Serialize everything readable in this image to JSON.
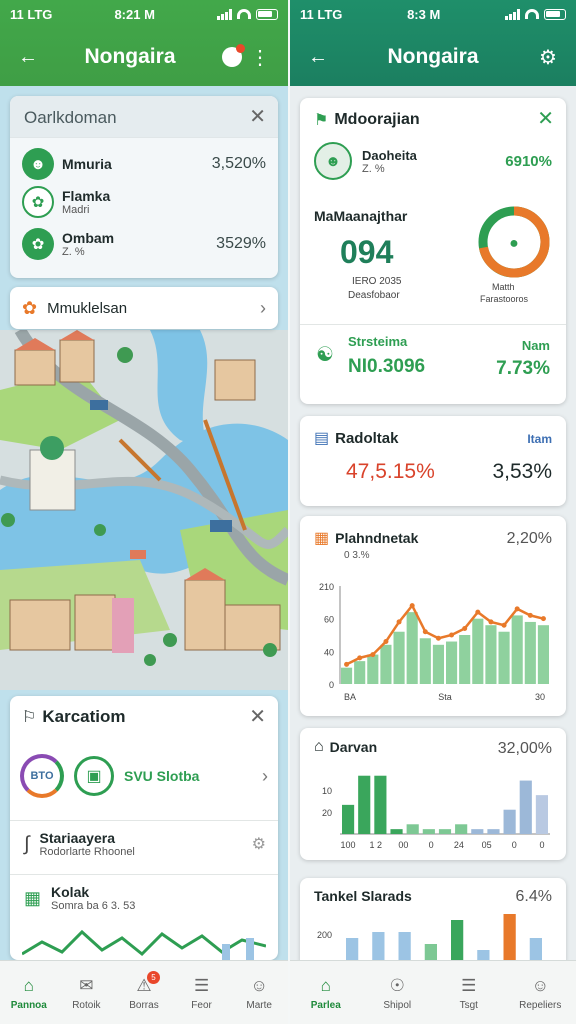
{
  "left": {
    "status": {
      "time_left": "11 LTG",
      "time": "8:21 M"
    },
    "appbar": {
      "title": "Nongaira"
    },
    "overview_card": {
      "title": "Oarlkdoman",
      "items": [
        {
          "label": "Mmuria",
          "sub": "",
          "value": "3,520%",
          "icon": "people-icon"
        },
        {
          "label": "Flamka",
          "sub": "Madri",
          "value": "",
          "icon": "leaf-icon"
        },
        {
          "label": "Ombam",
          "sub": "Z. %",
          "value": "3529%",
          "icon": "leaf-icon"
        }
      ]
    },
    "search_card": {
      "label": "Mmuklelsan"
    },
    "lower_card": {
      "title": "Karcatiom",
      "org_badge": "BTO",
      "link_label": "SVU Slotba",
      "items": [
        {
          "label": "Stariaayera",
          "sub": "Rodorlarte Rhoonel"
        },
        {
          "label": "Kolak",
          "sub": "Somra ba 6 3. 53"
        }
      ]
    },
    "nav": [
      {
        "label": "Pannoa",
        "icon": "home-icon",
        "active": true
      },
      {
        "label": "Rotoik",
        "icon": "chat-icon",
        "active": false
      },
      {
        "label": "Borras",
        "icon": "alert-icon",
        "active": false,
        "badge": "5"
      },
      {
        "label": "Feor",
        "icon": "database-icon",
        "active": false
      },
      {
        "label": "Marte",
        "icon": "user-icon",
        "active": false
      }
    ]
  },
  "right": {
    "status": {
      "time_left": "11 LTG",
      "time": "8:3 M"
    },
    "appbar": {
      "title": "Nongaira"
    },
    "metrics_card": {
      "title": "Mdoorajian",
      "top_item": {
        "label": "Daoheita",
        "sub": "Z. %",
        "value": "6910%"
      },
      "section_label": "MaMaanajthar",
      "big_number": "094",
      "big_sub1": "IERO 2035",
      "big_sub2": "Deasfobaor",
      "gauge_value": 0.72,
      "gauge_label1": "Matth",
      "gauge_label2": "Farastooros",
      "footer_left_label": "Strsteima",
      "footer_left_value": "NI0.3096",
      "footer_right_label": "Nam",
      "footer_right_value": "7.73%"
    },
    "stat_card": {
      "title": "Radoltak",
      "right_label": "Itam",
      "value_left": "47,5.15%",
      "value_right": "3,53%"
    },
    "line_card": {
      "title": "Plahndnetak",
      "sub": "0 3.%",
      "value": "2,20%",
      "chart_data": {
        "type": "bar",
        "y_ticks": [
          "210",
          "60",
          "40",
          "0"
        ],
        "x_ticks": [
          "BA",
          "Sta",
          "30"
        ],
        "values": [
          5,
          7,
          9,
          12,
          16,
          22,
          14,
          12,
          13,
          15,
          20,
          18,
          16,
          21,
          19,
          18
        ],
        "line": [
          6,
          8,
          9,
          13,
          19,
          24,
          16,
          14,
          15,
          17,
          22,
          19,
          18,
          23,
          21,
          20
        ],
        "ymax": 30
      }
    },
    "bar_card": {
      "title": "Darvan",
      "value": "32,00%",
      "chart_data": {
        "type": "bar",
        "y_ticks": [
          "20",
          "10"
        ],
        "x_ticks": [
          "100",
          "1 2",
          "00",
          "0",
          "24",
          "05",
          "0",
          "0"
        ],
        "values": [
          6,
          12,
          12,
          1,
          2,
          1,
          1,
          2,
          1,
          1,
          5,
          11,
          8
        ],
        "colors": [
          "#3aa65c",
          "#3aa65c",
          "#3aa65c",
          "#3aa65c",
          "#7dc894",
          "#7dc894",
          "#7dc894",
          "#7dc894",
          "#9cb8d8",
          "#9cb8d8",
          "#9cb8d8",
          "#9cb8d8",
          "#b9c9e2"
        ],
        "ymax": 14
      }
    },
    "tail_card": {
      "title": "Tankel Slarads",
      "value": "6.4%",
      "chart_data": {
        "type": "bar",
        "y_ticks": [
          "200"
        ],
        "values": [
          5,
          6,
          6,
          4,
          8,
          3,
          9,
          5
        ],
        "colors": [
          "#9cc4e4",
          "#9cc4e4",
          "#9cc4e4",
          "#7dc894",
          "#3aa65c",
          "#9cc4e4",
          "#e8792a",
          "#9cc4e4"
        ],
        "ymax": 10
      }
    },
    "nav": [
      {
        "label": "Parlea",
        "icon": "home-icon",
        "active": true
      },
      {
        "label": "Shipol",
        "icon": "compass-icon",
        "active": false
      },
      {
        "label": "Tsgt",
        "icon": "database-icon",
        "active": false
      },
      {
        "label": "Repeliers",
        "icon": "user-icon",
        "active": false
      }
    ]
  },
  "colors": {
    "green": "#2ea04f",
    "green_dark": "#1f8a5a",
    "orange": "#e8792a",
    "red": "#d9432b"
  }
}
